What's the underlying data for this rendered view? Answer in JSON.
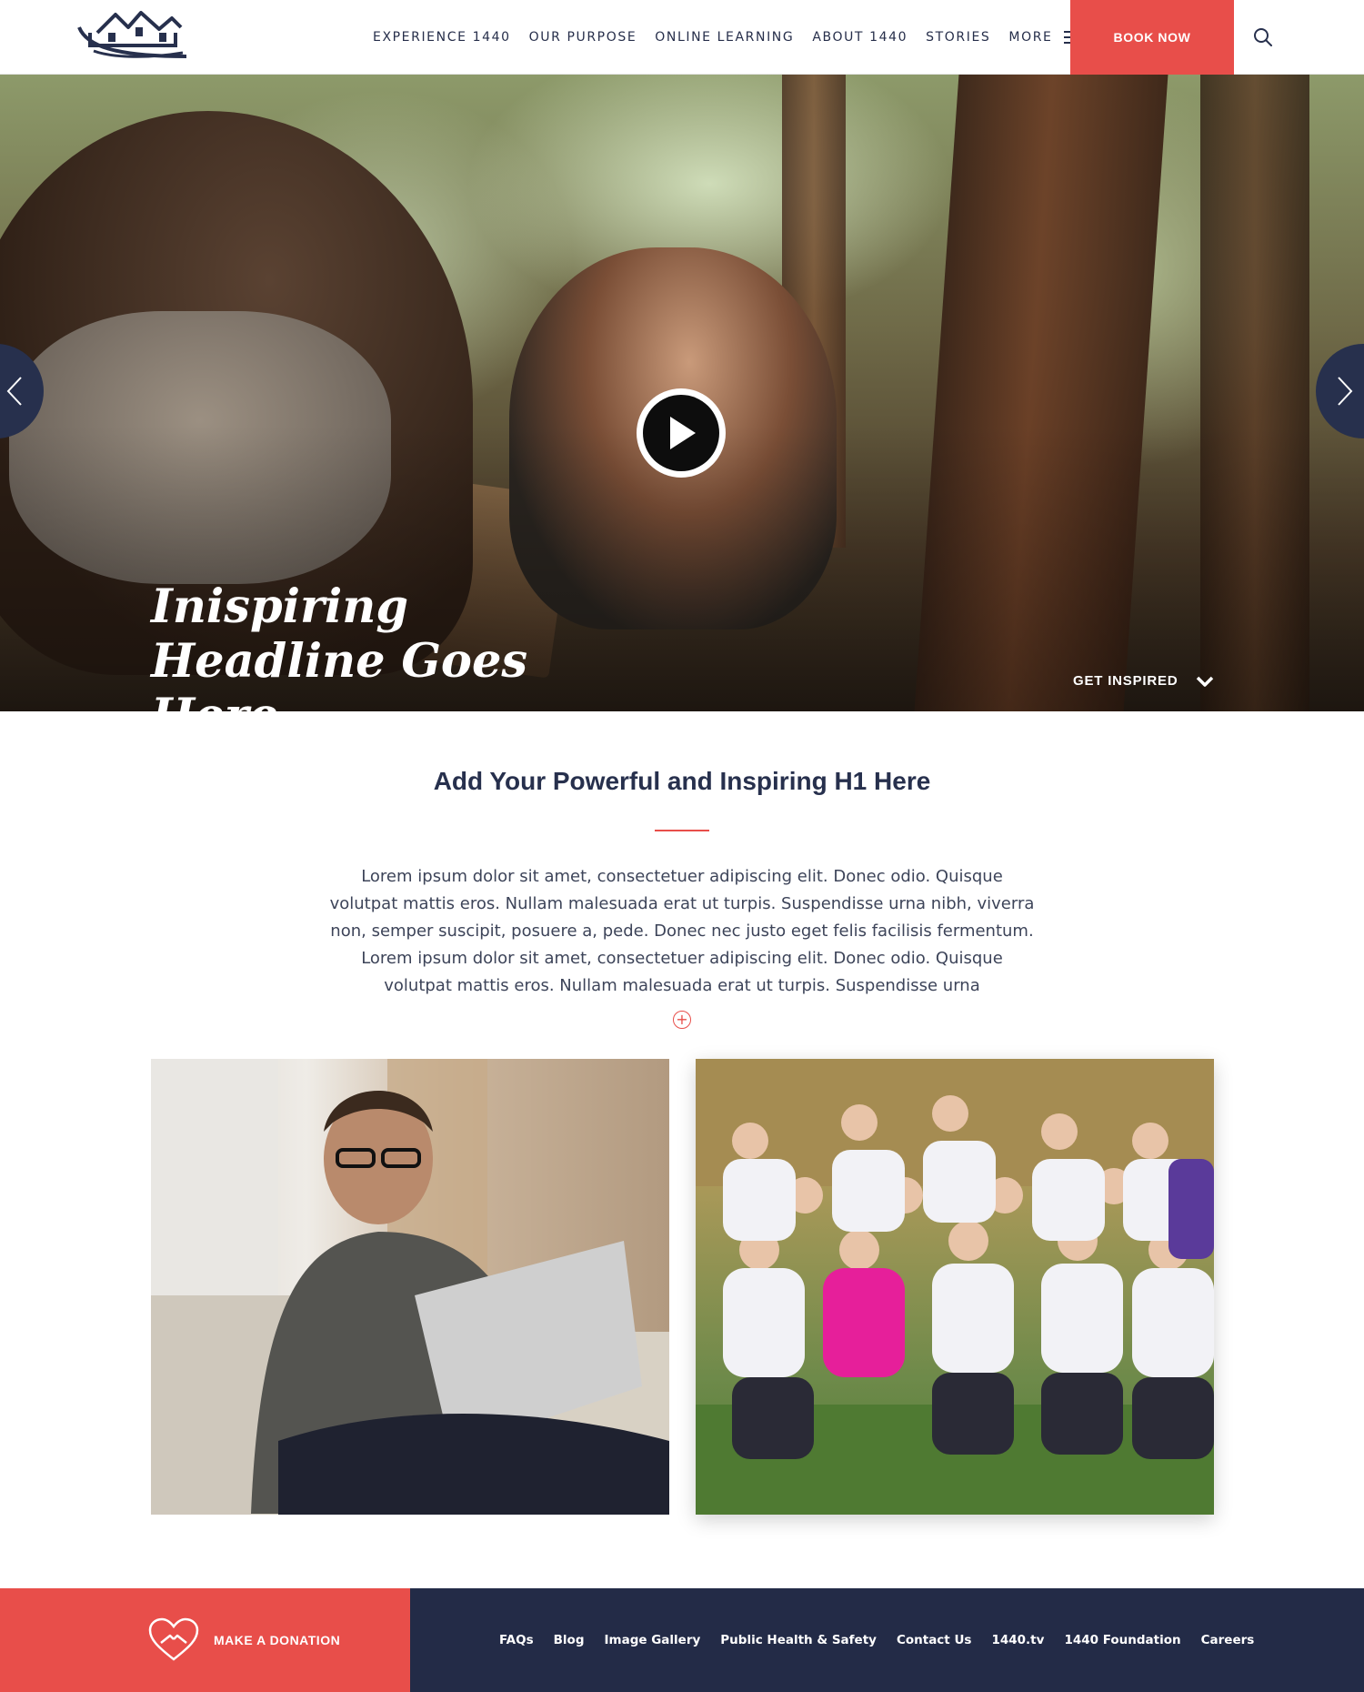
{
  "header": {
    "logo_icon": "lodge-logo-icon",
    "nav": [
      {
        "label": "EXPERIENCE 1440"
      },
      {
        "label": "OUR PURPOSE"
      },
      {
        "label": "ONLINE LEARNING"
      },
      {
        "label": "ABOUT 1440"
      },
      {
        "label": "STORIES"
      }
    ],
    "more_label": "MORE",
    "book_label": "BOOK NOW",
    "search_icon": "search-icon"
  },
  "hero": {
    "headline": "Inispiring Headline Goes Here",
    "cta_label": "GET INSPIRED",
    "prev_icon": "chevron-left-icon",
    "next_icon": "chevron-right-icon",
    "play_icon": "play-icon"
  },
  "intro": {
    "heading": "Add Your Powerful and Inspiring H1 Here",
    "body": "Lorem ipsum dolor sit amet, consectetuer adipiscing elit. Donec odio. Quisque volutpat mattis eros. Nullam malesuada erat ut turpis. Suspendisse urna nibh, viverra non, semper suscipit, posuere a, pede. Donec nec justo eget felis facilisis fermentum. Lorem ipsum dolor sit amet, consectetuer adipiscing elit. Donec odio. Quisque volutpat mattis eros. Nullam malesuada erat ut turpis. Suspendisse urna",
    "expand_icon": "plus-circle-icon"
  },
  "photos": {
    "left_image": "man-with-laptop-photo",
    "right_image": "group-gardening-club-photo"
  },
  "footer": {
    "donate_label": "MAKE A DONATION",
    "donate_icon": "heart-hands-icon",
    "links": [
      {
        "label": "FAQs"
      },
      {
        "label": "Blog"
      },
      {
        "label": "Image Gallery"
      },
      {
        "label": "Public Health & Safety"
      },
      {
        "label": "Contact Us"
      },
      {
        "label": "1440.tv"
      },
      {
        "label": "1440 Foundation"
      },
      {
        "label": "Careers"
      }
    ]
  },
  "colors": {
    "accent": "#e84e4a",
    "navy": "#232b47",
    "text": "#27304d"
  }
}
